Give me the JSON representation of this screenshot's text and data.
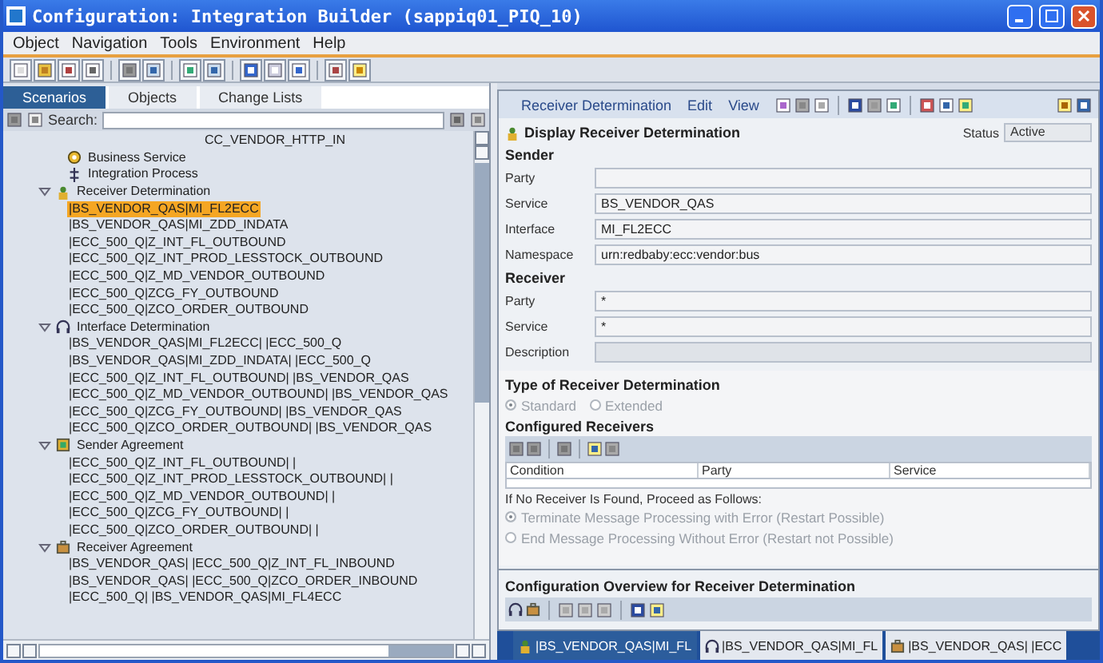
{
  "window": {
    "title": "Configuration: Integration Builder (sappiq01_PIQ_10)"
  },
  "menu": [
    "Object",
    "Navigation",
    "Tools",
    "Environment",
    "Help"
  ],
  "left_panel": {
    "tabs": [
      {
        "label": "Scenarios",
        "selected": true
      },
      {
        "label": "Objects",
        "selected": false
      },
      {
        "label": "Change Lists",
        "selected": false
      }
    ],
    "search": {
      "label": "Search:"
    },
    "tree": {
      "continued": [
        {
          "label": "CC_VENDOR_HTTP_IN",
          "kind": "channel"
        },
        {
          "label": "Business Service",
          "kind": "business-service"
        },
        {
          "label": "Integration Process",
          "kind": "integration-process"
        }
      ],
      "nodes": [
        {
          "label": "Receiver Determination",
          "kind": "receiver-determination",
          "expanded": true,
          "children": [
            {
              "label": "|BS_VENDOR_QAS|MI_FL2ECC",
              "selected": true
            },
            {
              "label": "|BS_VENDOR_QAS|MI_ZDD_INDATA",
              "selected": false
            },
            {
              "label": "|ECC_500_Q|Z_INT_FL_OUTBOUND",
              "selected": false
            },
            {
              "label": "|ECC_500_Q|Z_INT_PROD_LESSTOCK_OUTBOUND",
              "selected": false
            },
            {
              "label": "|ECC_500_Q|Z_MD_VENDOR_OUTBOUND",
              "selected": false
            },
            {
              "label": "|ECC_500_Q|ZCG_FY_OUTBOUND",
              "selected": false
            },
            {
              "label": "|ECC_500_Q|ZCO_ORDER_OUTBOUND",
              "selected": false
            }
          ]
        },
        {
          "label": "Interface Determination",
          "kind": "interface-determination",
          "expanded": true,
          "children": [
            {
              "label": "|BS_VENDOR_QAS|MI_FL2ECC| |ECC_500_Q",
              "selected": false
            },
            {
              "label": "|BS_VENDOR_QAS|MI_ZDD_INDATA| |ECC_500_Q",
              "selected": false
            },
            {
              "label": "|ECC_500_Q|Z_INT_FL_OUTBOUND| |BS_VENDOR_QAS",
              "selected": false
            },
            {
              "label": "|ECC_500_Q|Z_MD_VENDOR_OUTBOUND| |BS_VENDOR_QAS",
              "selected": false
            },
            {
              "label": "|ECC_500_Q|ZCG_FY_OUTBOUND| |BS_VENDOR_QAS",
              "selected": false
            },
            {
              "label": "|ECC_500_Q|ZCO_ORDER_OUTBOUND| |BS_VENDOR_QAS",
              "selected": false
            }
          ]
        },
        {
          "label": "Sender Agreement",
          "kind": "sender-agreement",
          "expanded": true,
          "children": [
            {
              "label": "|ECC_500_Q|Z_INT_FL_OUTBOUND| |",
              "selected": false
            },
            {
              "label": "|ECC_500_Q|Z_INT_PROD_LESSTOCK_OUTBOUND| |",
              "selected": false
            },
            {
              "label": "|ECC_500_Q|Z_MD_VENDOR_OUTBOUND| |",
              "selected": false
            },
            {
              "label": "|ECC_500_Q|ZCG_FY_OUTBOUND| |",
              "selected": false
            },
            {
              "label": "|ECC_500_Q|ZCO_ORDER_OUTBOUND| |",
              "selected": false
            }
          ]
        },
        {
          "label": "Receiver Agreement",
          "kind": "receiver-agreement",
          "expanded": true,
          "children": [
            {
              "label": "|BS_VENDOR_QAS| |ECC_500_Q|Z_INT_FL_INBOUND",
              "selected": false
            },
            {
              "label": "|BS_VENDOR_QAS| |ECC_500_Q|ZCO_ORDER_INBOUND",
              "selected": false
            },
            {
              "label": "|ECC_500_Q| |BS_VENDOR_QAS|MI_FL4ECC",
              "selected": false
            }
          ]
        }
      ]
    }
  },
  "editor": {
    "menu": [
      "Receiver Determination",
      "Edit",
      "View"
    ],
    "heading": "Display Receiver Determination",
    "status_label": "Status",
    "status": "Active",
    "sections": [
      {
        "title": "Sender",
        "fields": [
          {
            "label": "Party"
          },
          {
            "label": "Service",
            "value": "BS_VENDOR_QAS"
          },
          {
            "label": "Interface",
            "value": "MI_FL2ECC"
          },
          {
            "label": "Namespace",
            "value": "urn:redbaby:ecc:vendor:bus"
          }
        ]
      },
      {
        "title": "Receiver",
        "fields": [
          {
            "label": "Party",
            "value": "*"
          },
          {
            "label": "Service",
            "value": "*"
          },
          {
            "label": "Description",
            "disabled": true
          }
        ]
      }
    ],
    "type_section": {
      "title": "Type of Receiver Determination",
      "disabled": true,
      "options": [
        {
          "label": "Standard",
          "selected": true
        },
        {
          "label": "Extended",
          "selected": false
        }
      ]
    },
    "configured": {
      "title": "Configured Receivers",
      "columns": [
        "Condition",
        "Party",
        "Service"
      ]
    },
    "fallback": {
      "title": "If No Receiver Is Found, Proceed as Follows:",
      "disabled": true,
      "options": [
        {
          "label": "Terminate Message Processing with Error (Restart Possible)",
          "selected": true
        },
        {
          "label": "End Message Processing Without Error (Restart not Possible)",
          "selected": false
        }
      ]
    },
    "overview": {
      "title": "Configuration Overview for Receiver Determination"
    }
  },
  "bottom_tabs": [
    {
      "label": "|BS_VENDOR_QAS|MI_FL",
      "kind": "receiver-determination",
      "selected": true
    },
    {
      "label": "|BS_VENDOR_QAS|MI_FL",
      "kind": "interface-determination",
      "selected": false
    },
    {
      "label": "|BS_VENDOR_QAS| |ECC",
      "kind": "receiver-agreement",
      "selected": false
    }
  ]
}
